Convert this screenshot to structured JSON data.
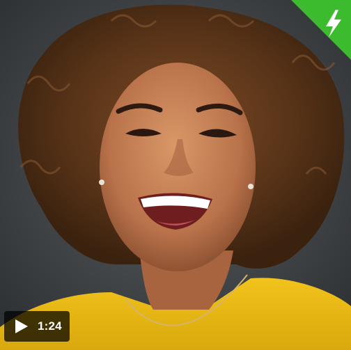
{
  "thumbnail": {
    "image": {
      "subject": "smiling-woman-curly-hair-yellow-top-icon"
    },
    "badge": {
      "icon": "lightning-bolt-icon",
      "color": "#3dbb2f"
    },
    "video": {
      "play_icon": "play-icon",
      "duration": "1:24"
    }
  }
}
